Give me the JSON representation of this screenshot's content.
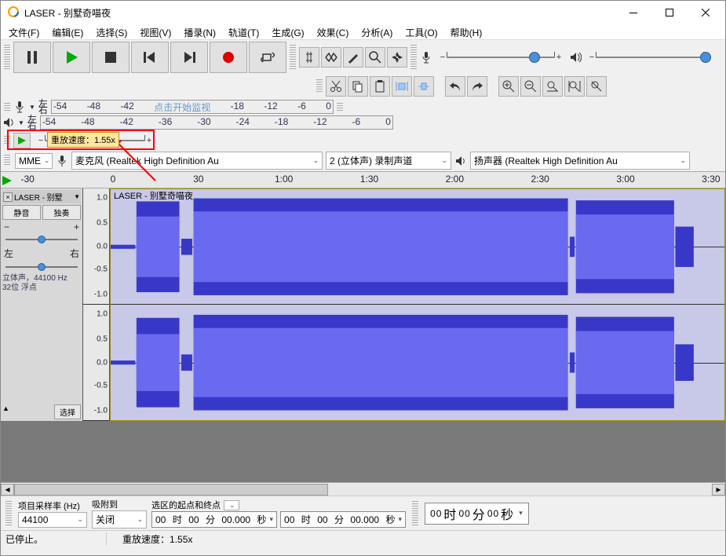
{
  "window": {
    "title": "LASER - 别墅奇喵夜"
  },
  "menu": {
    "file": "文件(F)",
    "edit": "编辑(E)",
    "select": "选择(S)",
    "view": "视图(V)",
    "transport": "播录(N)",
    "tracks": "轨道(T)",
    "generate": "生成(G)",
    "effect": "效果(C)",
    "analyze": "分析(A)",
    "tools": "工具(O)",
    "help": "帮助(H)"
  },
  "meter_rec": {
    "hint": "点击开始监视",
    "labels": [
      "-54",
      "-48",
      "-42",
      "",
      "-18",
      "-12",
      "-6",
      "0"
    ]
  },
  "meter_play": {
    "labels": [
      "-54",
      "-48",
      "-42",
      "-36",
      "-30",
      "-24",
      "-18",
      "-12",
      "-6",
      "0"
    ]
  },
  "lr": {
    "l": "左",
    "r": "右"
  },
  "tooltip": {
    "text": "重放速度：1.55x"
  },
  "device": {
    "host_label": "MME",
    "mic": "麦克风 (Realtek High Definition Au",
    "channels": "2 (立体声) 录制声道",
    "speaker": "扬声器 (Realtek High Definition Au"
  },
  "ruler": {
    "ticks": [
      "-30",
      "0",
      "30",
      "1:00",
      "1:30",
      "2:00",
      "2:30",
      "3:00",
      "3:30"
    ]
  },
  "track": {
    "name_short": "LASER - 别墅",
    "clip_name": "LASER - 别墅奇喵夜",
    "mute": "静音",
    "solo": "独奏",
    "pan_l": "左",
    "pan_r": "右",
    "info": "立体声，44100 Hz\n32位 浮点",
    "select": "选择",
    "vscale": [
      "1.0",
      "0.5",
      "0.0",
      "-0.5",
      "-1.0"
    ]
  },
  "selection": {
    "rate_label": "项目采样率 (Hz)",
    "rate": "44100",
    "snap_label": "吸附到",
    "snap": "关闭",
    "range_label": "选区的起点和终点",
    "start": {
      "h": "00",
      "m": "00",
      "s": "00.000",
      "uh": "时",
      "um": "分",
      "us": "秒"
    },
    "end": {
      "h": "00",
      "m": "00",
      "s": "00.000",
      "uh": "时",
      "um": "分",
      "us": "秒"
    },
    "pos": {
      "h": "00",
      "m": "00",
      "s": "00",
      "uh": "时",
      "um": "分",
      "us": "秒"
    }
  },
  "status": {
    "state": "已停止。",
    "speed": "重放速度：1.55x"
  }
}
